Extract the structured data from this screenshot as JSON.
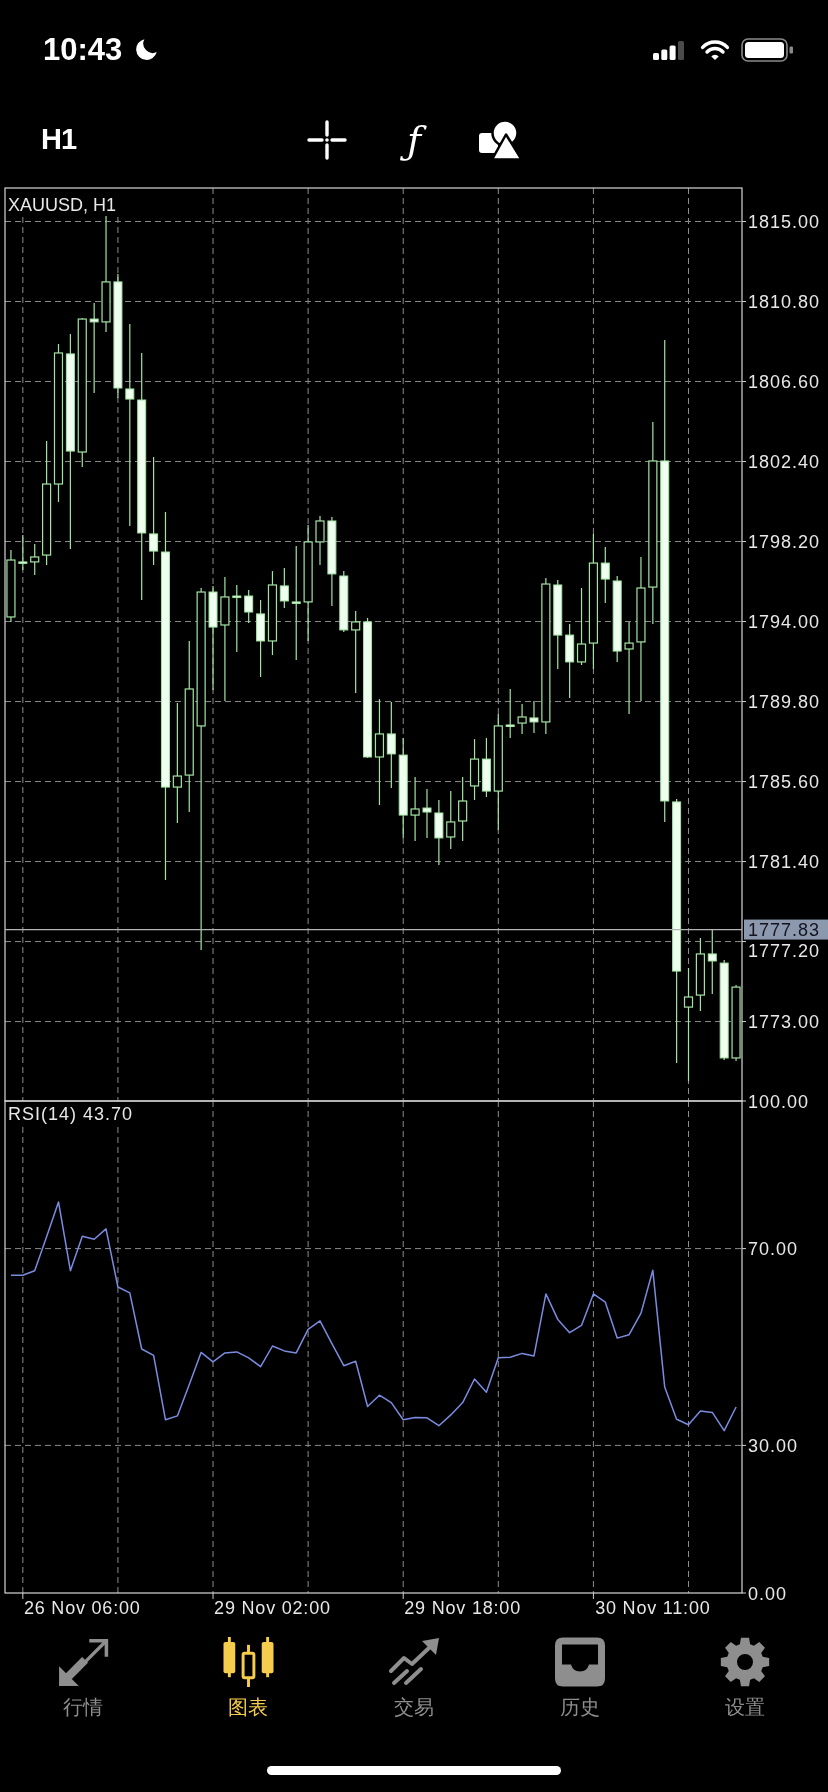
{
  "status_bar": {
    "time": "10:43"
  },
  "toolbar": {
    "timeframe": "H1",
    "indicators_glyph": "ƒ"
  },
  "chart": {
    "chart_data": {
      "type": "candlestick",
      "title": "XAUUSD, H1",
      "categories": [
        null,
        null,
        null,
        null,
        null,
        null,
        null,
        null,
        null,
        null,
        null,
        null,
        null,
        null,
        null,
        null,
        null,
        null,
        null,
        null,
        null,
        null,
        null,
        null,
        null,
        null,
        null,
        null,
        null,
        null,
        null,
        null,
        null,
        null,
        null,
        null,
        null,
        null,
        null,
        null,
        null,
        null,
        null,
        null,
        null,
        null,
        null,
        null,
        null,
        null,
        null,
        null,
        null,
        null,
        null,
        null,
        null,
        null,
        null,
        null,
        null,
        null
      ],
      "ohlc": [
        [
          1794.24,
          1797.76,
          1793.98,
          1797.23
        ],
        [
          1797.13,
          1798.54,
          1796.71,
          1797.13
        ],
        [
          1797.13,
          1798.07,
          1796.44,
          1797.39
        ],
        [
          1797.49,
          1803.48,
          1796.97,
          1801.22
        ],
        [
          1801.22,
          1808.57,
          1800.28,
          1808.1
        ],
        [
          1808.05,
          1809.1,
          1797.81,
          1802.95
        ],
        [
          1802.9,
          1809.94,
          1802.11,
          1809.88
        ],
        [
          1809.88,
          1810.72,
          1806.0,
          1809.73
        ],
        [
          1809.73,
          1815.29,
          1809.2,
          1811.83
        ],
        [
          1811.83,
          1812.25,
          1805.74,
          1806.26
        ],
        [
          1806.21,
          1809.62,
          1799.02,
          1805.68
        ],
        [
          1805.63,
          1808.1,
          1795.13,
          1798.65
        ],
        [
          1798.6,
          1802.64,
          1796.97,
          1797.7
        ],
        [
          1797.65,
          1799.75,
          1780.43,
          1785.31
        ],
        [
          1785.31,
          1789.72,
          1783.42,
          1785.89
        ],
        [
          1785.94,
          1792.98,
          1784.0,
          1790.46
        ],
        [
          1788.52,
          1795.76,
          1776.76,
          1795.55
        ],
        [
          1795.55,
          1795.87,
          1790.41,
          1793.71
        ],
        [
          1793.82,
          1796.34,
          1789.83,
          1795.29
        ],
        [
          1795.34,
          1795.92,
          1792.4,
          1795.34
        ],
        [
          1795.34,
          1795.66,
          1793.92,
          1794.5
        ],
        [
          1794.4,
          1795.13,
          1791.09,
          1792.98
        ],
        [
          1792.98,
          1796.65,
          1792.24,
          1795.92
        ],
        [
          1795.87,
          1796.81,
          1794.71,
          1795.08
        ],
        [
          1795.03,
          1797.97,
          1791.98,
          1795.03
        ],
        [
          1795.03,
          1799.07,
          1792.98,
          1798.18
        ],
        [
          1798.18,
          1799.54,
          1796.97,
          1799.28
        ],
        [
          1799.28,
          1799.49,
          1794.82,
          1796.5
        ],
        [
          1796.39,
          1796.65,
          1793.45,
          1793.56
        ],
        [
          1793.56,
          1794.55,
          1790.25,
          1793.98
        ],
        [
          1793.98,
          1794.19,
          1786.84,
          1786.89
        ],
        [
          1786.89,
          1789.93,
          1784.37,
          1788.1
        ],
        [
          1788.1,
          1789.78,
          1785.26,
          1787.05
        ],
        [
          1786.99,
          1787.89,
          1782.64,
          1783.84
        ],
        [
          1783.84,
          1785.84,
          1782.48,
          1784.16
        ],
        [
          1784.21,
          1785.21,
          1782.64,
          1784.0
        ],
        [
          1783.95,
          1784.63,
          1781.22,
          1782.64
        ],
        [
          1782.69,
          1785.1,
          1782.06,
          1783.48
        ],
        [
          1783.53,
          1785.84,
          1782.48,
          1784.58
        ],
        [
          1785.37,
          1787.83,
          1784.63,
          1786.78
        ],
        [
          1786.78,
          1787.89,
          1784.79,
          1785.1
        ],
        [
          1785.1,
          1789.15,
          1783.06,
          1788.52
        ],
        [
          1788.57,
          1790.46,
          1787.89,
          1788.57
        ],
        [
          1788.67,
          1789.67,
          1788.1,
          1788.99
        ],
        [
          1788.94,
          1789.83,
          1788.15,
          1788.73
        ],
        [
          1788.73,
          1796.29,
          1788.1,
          1795.97
        ],
        [
          1795.92,
          1796.18,
          1791.51,
          1793.29
        ],
        [
          1793.29,
          1793.87,
          1789.99,
          1791.88
        ],
        [
          1791.88,
          1795.76,
          1791.72,
          1792.82
        ],
        [
          1792.87,
          1798.6,
          1791.51,
          1797.07
        ],
        [
          1797.07,
          1797.91,
          1794.97,
          1796.23
        ],
        [
          1796.13,
          1796.39,
          1791.88,
          1792.45
        ],
        [
          1792.56,
          1793.98,
          1789.15,
          1792.87
        ],
        [
          1792.93,
          1797.39,
          1789.83,
          1795.76
        ],
        [
          1795.81,
          1804.48,
          1793.87,
          1802.43
        ],
        [
          1802.43,
          1808.78,
          1783.48,
          1784.58
        ],
        [
          1784.53,
          1784.68,
          1770.82,
          1775.65
        ],
        [
          1773.76,
          1775.81,
          1769.88,
          1774.29
        ],
        [
          1774.39,
          1777.39,
          1773.55,
          1776.55
        ],
        [
          1776.55,
          1777.86,
          1774.45,
          1776.18
        ],
        [
          1776.07,
          1776.23,
          1770.98,
          1771.09
        ],
        [
          1771.09,
          1774.92,
          1770.93,
          1774.81
        ]
      ],
      "ylim": [
        1768.83,
        1816.76
      ],
      "yticks": [
        {
          "value": 1815.0,
          "label": "1815.00"
        },
        {
          "value": 1810.8,
          "label": "1810.80"
        },
        {
          "value": 1806.6,
          "label": "1806.60"
        },
        {
          "value": 1802.4,
          "label": "1802.40"
        },
        {
          "value": 1798.2,
          "label": "1798.20"
        },
        {
          "value": 1794.0,
          "label": "1794.00"
        },
        {
          "value": 1789.8,
          "label": "1789.80"
        },
        {
          "value": 1785.6,
          "label": "1785.60"
        },
        {
          "value": 1781.4,
          "label": "1781.40"
        },
        {
          "value": 1777.2,
          "label": "1777.20"
        },
        {
          "value": 1773.0,
          "label": "1773.00"
        }
      ],
      "grid": true,
      "ref_lines": [
        {
          "axis": "y",
          "value": 1777.83,
          "label": "1777.83"
        }
      ]
    }
  },
  "indicator": {
    "chart_data": {
      "type": "line",
      "title": "RSI(14) 43.70",
      "categories": [
        null,
        null,
        null,
        null,
        null,
        null,
        "26 Nov 06:00",
        null,
        null,
        null,
        null,
        null,
        null,
        null,
        null,
        null,
        null,
        null,
        null,
        null,
        null,
        null,
        "29 Nov 02:00",
        null,
        null,
        null,
        null,
        null,
        null,
        null,
        null,
        null,
        null,
        null,
        null,
        null,
        null,
        null,
        "29 Nov 18:00",
        null,
        null,
        null,
        null,
        null,
        null,
        null,
        null,
        null,
        null,
        null,
        null,
        null,
        null,
        null,
        "30 Nov 11:00",
        null,
        null,
        null,
        null,
        null,
        null,
        null
      ],
      "series": [
        {
          "color": "#7b8be0",
          "values": [
            64.6,
            64.6,
            65.5,
            72.4,
            79.5,
            65.5,
            72.5,
            71.9,
            74.0,
            62.2,
            61.0,
            49.6,
            48.3,
            35.2,
            36.0,
            42.4,
            48.9,
            47.0,
            48.8,
            49.0,
            47.8,
            46.0,
            50.2,
            49.2,
            48.8,
            53.6,
            55.3,
            50.7,
            46.2,
            47.1,
            37.9,
            40.2,
            38.7,
            35.2,
            35.7,
            35.6,
            34.0,
            36.2,
            38.7,
            43.5,
            40.8,
            47.8,
            47.9,
            48.7,
            48.2,
            60.8,
            55.6,
            52.9,
            54.4,
            60.8,
            59.1,
            51.8,
            52.5,
            56.9,
            65.6,
            41.9,
            35.3,
            34.2,
            37.0,
            36.7,
            33.0,
            37.8
          ]
        }
      ],
      "ylim": [
        0,
        100
      ],
      "yticks": [
        {
          "value": 100,
          "label": "100.00"
        },
        {
          "value": 70,
          "label": "70.00"
        },
        {
          "value": 30,
          "label": "30.00"
        },
        {
          "value": 0,
          "label": "0.00"
        }
      ],
      "grid": true
    }
  },
  "tabs": [
    {
      "label": "行情",
      "selected": false
    },
    {
      "label": "图表",
      "selected": true
    },
    {
      "label": "交易",
      "selected": false
    },
    {
      "label": "历史",
      "selected": false
    },
    {
      "label": "设置",
      "selected": false
    }
  ]
}
